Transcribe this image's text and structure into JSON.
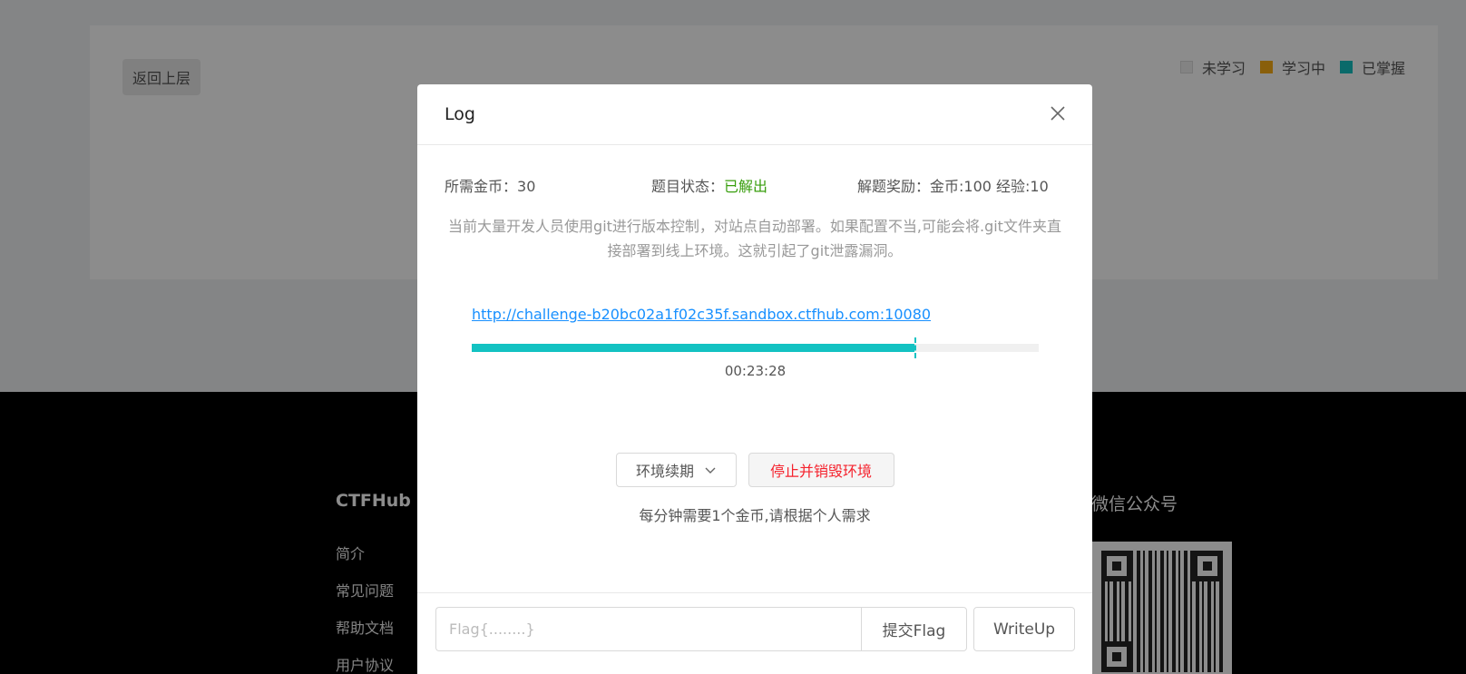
{
  "page": {
    "back_label": "返回上层",
    "legend": [
      {
        "label": "未学习",
        "color": "#eeeeee"
      },
      {
        "label": "学习中",
        "color": "#faad14"
      },
      {
        "label": "已掌握",
        "color": "#13c2c2"
      }
    ]
  },
  "footer": {
    "brand": "CTFHub",
    "links": [
      "简介",
      "常见问题",
      "帮助文档",
      "用户协议"
    ],
    "wechat_title": "微信公众号"
  },
  "modal": {
    "title": "Log",
    "required_coins_label": "所需金币：",
    "required_coins_value": "30",
    "status_label": "题目状态：",
    "status_value": "已解出",
    "reward_label": "解题奖励：",
    "reward_value": "金币:100 经验:10",
    "description": "当前大量开发人员使用git进行版本控制，对站点自动部署。如果配置不当,可能会将.git文件夹直接部署到线上环境。这就引起了git泄露漏洞。",
    "env_url": "http://challenge-b20bc02a1f02c35f.sandbox.ctfhub.com:10080",
    "progress_percent": 78,
    "timer": "00:23:28",
    "renew_label": "环境续期",
    "destroy_label": "停止并销毁环境",
    "hint": "每分钟需要1个金币,请根据个人需求",
    "flag_placeholder": "Flag{........}",
    "submit_label": "提交Flag",
    "writeup_label": "WriteUp"
  },
  "colors": {
    "accent": "#13c2c2",
    "link": "#1890ff",
    "success": "#389e0d",
    "danger": "#f5222d"
  }
}
